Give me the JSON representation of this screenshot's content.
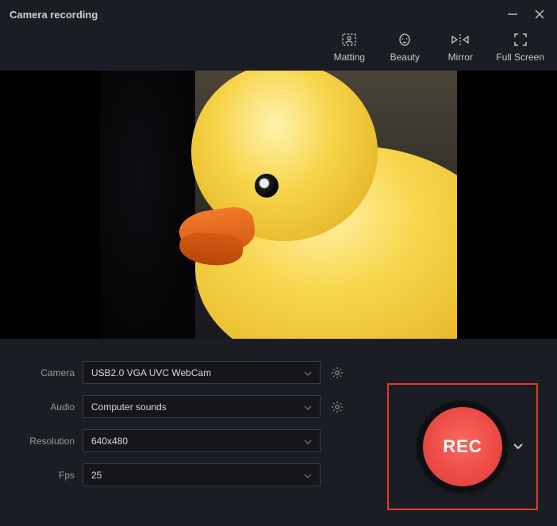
{
  "window": {
    "title": "Camera recording"
  },
  "toolbar": {
    "matting": "Matting",
    "beauty": "Beauty",
    "mirror": "Mirror",
    "fullscreen": "Full Screen"
  },
  "settings": {
    "camera": {
      "label": "Camera",
      "value": "USB2.0 VGA UVC WebCam"
    },
    "audio": {
      "label": "Audio",
      "value": "Computer sounds"
    },
    "resolution": {
      "label": "Resolution",
      "value": "640x480"
    },
    "fps": {
      "label": "Fps",
      "value": "25"
    }
  },
  "record": {
    "label": "REC"
  }
}
